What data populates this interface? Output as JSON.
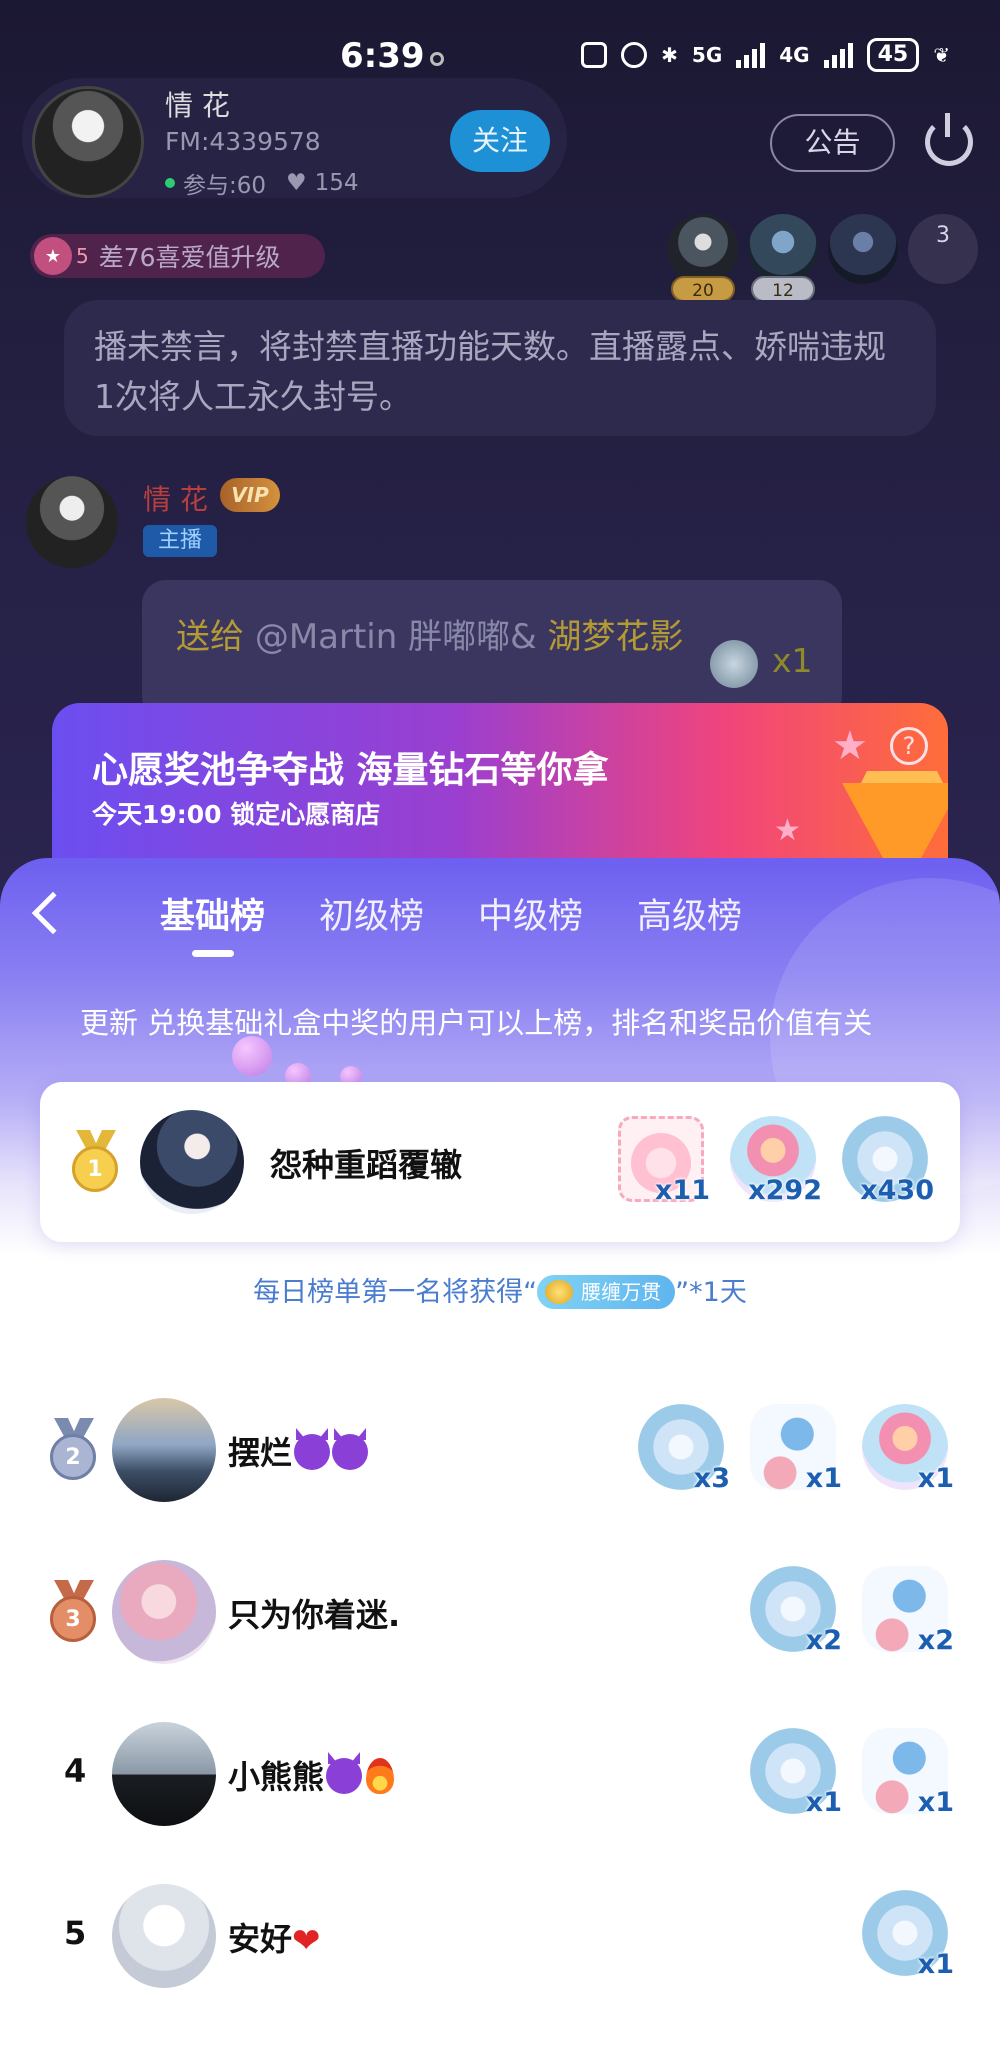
{
  "status_bar": {
    "time": "6:39",
    "net1": "5G",
    "net2": "4G",
    "battery": "45"
  },
  "room": {
    "host_name": "情 花",
    "host_fm": "FM:4339578",
    "participants": "参与:60",
    "likes": "154",
    "follow_label": "关注",
    "notice_label": "公告",
    "level_num": "5",
    "level_text": "差76喜爱值升级",
    "viewer_tags": [
      "20",
      "12"
    ],
    "viewer_count": "3",
    "system_message": "播未禁言，将封禁直播功能天数。直播露点、娇喘违规1次将人工永久封号。",
    "msg_name": "情 花",
    "msg_vip": "VIP",
    "msg_role": "主播",
    "gift_send": "送给",
    "gift_target": "@Martin 胖嘟嘟&",
    "gift_target2": "湖梦花影",
    "gift_count": "x1"
  },
  "banner": {
    "title": "心愿奖池争夺战 海量钻石等你拿",
    "subtitle": "今天19:00 锁定心愿商店",
    "help": "?"
  },
  "leaderboard": {
    "tabs": [
      {
        "label": "基础榜"
      },
      {
        "label": "初级榜"
      },
      {
        "label": "中级榜"
      },
      {
        "label": "高级榜"
      }
    ],
    "hint": "更新 兑换基础礼盒中奖的用户可以上榜，排名和奖品价值有关",
    "first": {
      "rank": "1",
      "name": "怨种重蹈覆辙",
      "gifts": [
        {
          "icon": "gift-box-icon",
          "count": "x11"
        },
        {
          "icon": "mermaid-icon",
          "count": "x292"
        },
        {
          "icon": "shell-icon",
          "count": "x430"
        }
      ]
    },
    "reward_note_prefix": "每日榜单第一名将获得“",
    "reward_chip": "腰缠万贯",
    "reward_note_suffix": "”*1天",
    "rows": [
      {
        "rank": "2",
        "name": "摆烂",
        "gifts": [
          {
            "icon": "shell-icon",
            "count": "x3"
          },
          {
            "icon": "seahorse-icon",
            "count": "x1"
          },
          {
            "icon": "mermaid-icon",
            "count": "x1"
          }
        ]
      },
      {
        "rank": "3",
        "name": "只为你着迷.",
        "gifts": [
          {
            "icon": "shell-icon",
            "count": "x2"
          },
          {
            "icon": "seahorse-icon",
            "count": "x2"
          }
        ]
      },
      {
        "rank": "4",
        "name": "小熊熊",
        "gifts": [
          {
            "icon": "shell-icon",
            "count": "x1"
          },
          {
            "icon": "seahorse-icon",
            "count": "x1"
          }
        ]
      },
      {
        "rank": "5",
        "name": "安好",
        "gifts": [
          {
            "icon": "shell-icon",
            "count": "x1"
          }
        ]
      }
    ]
  }
}
